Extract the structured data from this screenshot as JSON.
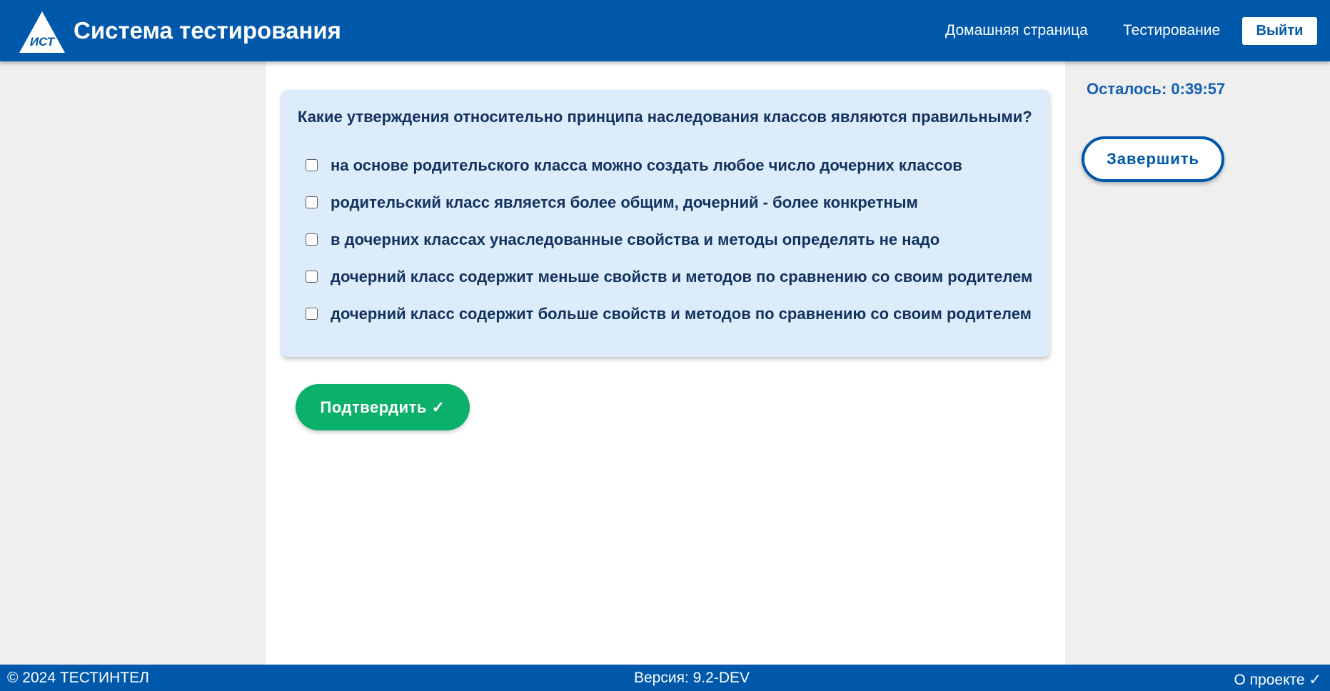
{
  "header": {
    "logo_icon": "triangle-ist-logo-icon",
    "logo_letters": "ИСТ",
    "title": "Система тестирования",
    "nav": [
      {
        "label": "Домашняя страница"
      },
      {
        "label": "Тестирование"
      }
    ],
    "logout_label": "Выйти"
  },
  "question": {
    "text": "Какие утверждения относительно принципа наследования классов являются правильными?",
    "options": [
      {
        "label": "на основе родительского класса можно создать любое число дочерних классов",
        "checked": false
      },
      {
        "label": "родительский класс является более общим, дочерний - более конкретным",
        "checked": false
      },
      {
        "label": "в дочерних классах унаследованные свойства и методы определять не надо",
        "checked": false
      },
      {
        "label": "дочерний класс содержит меньше свойств и методов по сравнению со своим родителем",
        "checked": false
      },
      {
        "label": "дочерний класс содержит больше свойств и методов по сравнению со своим родителем",
        "checked": false
      }
    ],
    "confirm_label": "Подтвердить ✓"
  },
  "sidebar": {
    "timer": "Осталось: 0:39:57",
    "finish_label": "Завершить"
  },
  "footer": {
    "copyright": "© 2024 ТЕСТИНТЕЛ",
    "version": "Версия: 9.2-DEV",
    "about": "О проекте ✓"
  },
  "colors": {
    "primary": "#0058aa",
    "card_bg": "#ddecfb",
    "confirm_green": "#0bb16b",
    "text_dark": "#12325e",
    "page_bg": "#efefef"
  }
}
